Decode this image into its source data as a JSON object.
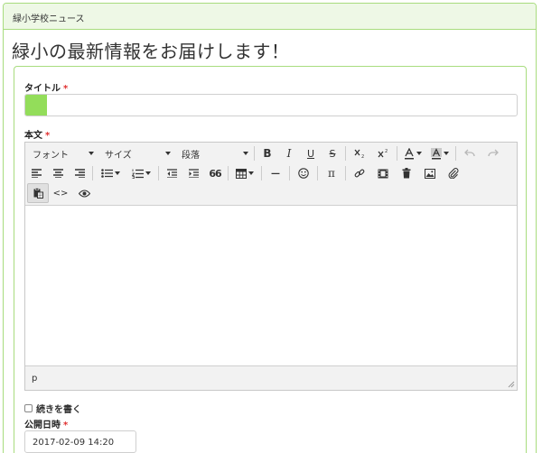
{
  "panel": {
    "header": "緑小学校ニュース"
  },
  "page": {
    "title": "緑小の最新情報をお届けします！"
  },
  "form": {
    "title_label": "タイトル",
    "required_mark": "*",
    "title_progress": 0.045,
    "body_label": "本文",
    "editor": {
      "font_label": "フォント",
      "size_label": "サイズ",
      "format_label": "段落",
      "bold": "B",
      "italic": "I",
      "underline": "U",
      "strike": "S",
      "blockquote": "66",
      "hr": "—",
      "pi": "π",
      "source": "<>",
      "path": "p"
    },
    "continue_label": "続きを書く",
    "date_label": "公開日時",
    "date_value": "2017-02-09 14:20"
  }
}
